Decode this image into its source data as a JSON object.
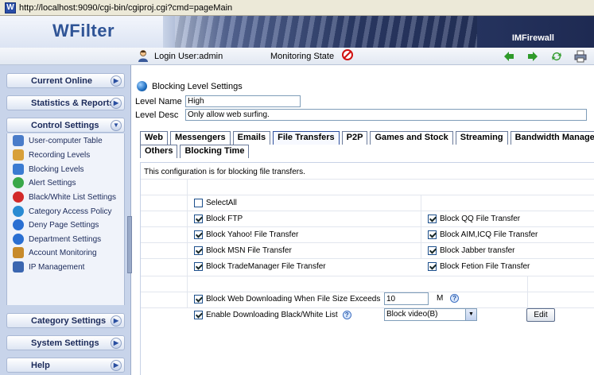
{
  "address_bar": {
    "icon": "wfilter-app-icon",
    "url": "http://localhost:9090/cgi-bin/cgiproj.cgi?cmd=pageMain"
  },
  "banner": {
    "brand": "WFilter",
    "product": "IMFirewall"
  },
  "status_bar": {
    "login": "Login User:admin",
    "monitoring": "Monitoring State",
    "icons": [
      "user-icon",
      "stop-icon",
      "back-arrow-icon",
      "forward-arrow-icon",
      "refresh-icon",
      "print-icon"
    ],
    "colors": {
      "green": "#2f9a2a",
      "stop_red": "#d01010"
    }
  },
  "sidebar": {
    "sections": [
      {
        "label": "Current Online"
      },
      {
        "label": "Statistics & Reports"
      },
      {
        "label": "Control Settings"
      },
      {
        "label": "Category Settings"
      },
      {
        "label": "System Settings"
      },
      {
        "label": "Help"
      }
    ],
    "items": [
      {
        "label": "User-computer Table",
        "icon": "user-table-icon",
        "color": "#4a7cc9"
      },
      {
        "label": "Recording Levels",
        "icon": "recording-icon",
        "color": "#d8a03a"
      },
      {
        "label": "Blocking Levels",
        "icon": "blocking-icon",
        "color": "#3b7bd2"
      },
      {
        "label": "Alert Settings",
        "icon": "alert-icon",
        "color": "#3aa84a"
      },
      {
        "label": "Black/White List Settings",
        "icon": "list-icon",
        "color": "#d22a2a"
      },
      {
        "label": "Category Access Policy",
        "icon": "category-icon",
        "color": "#2a8bd2"
      },
      {
        "label": "Deny Page Settings",
        "icon": "deny-page-icon",
        "color": "#2a6fd2"
      },
      {
        "label": "Department Settings",
        "icon": "department-icon",
        "color": "#2a6fd2"
      },
      {
        "label": "Account Monitoring",
        "icon": "account-icon",
        "color": "#c78a2a"
      },
      {
        "label": "IP Management",
        "icon": "ip-icon",
        "color": "#3b66b0"
      }
    ]
  },
  "main": {
    "title": "Blocking Level Settings",
    "level_name": {
      "label": "Level Name",
      "value": "High"
    },
    "level_desc": {
      "label": "Level Desc",
      "value": "Only allow web surfing."
    },
    "tabs_row1": [
      "Web",
      "Messengers",
      "Emails",
      "File Transfers",
      "P2P",
      "Games and Stock",
      "Streaming",
      "Bandwidth Manage"
    ],
    "tabs_row2": [
      "Others",
      "Blocking Time"
    ],
    "active_tab": "File Transfers",
    "description": "This configuration is for blocking file transfers.",
    "select_all": {
      "label": "SelectAll",
      "checked": false
    },
    "options_left": [
      {
        "label": "Block FTP",
        "checked": true
      },
      {
        "label": "Block Yahoo! File Transfer",
        "checked": true
      },
      {
        "label": "Block MSN File Transfer",
        "checked": true
      },
      {
        "label": "Block TradeManager File Transfer",
        "checked": true
      }
    ],
    "options_right": [
      {
        "label": "Block QQ File Transfer",
        "checked": true
      },
      {
        "label": "Block AIM,ICQ File Transfer",
        "checked": true
      },
      {
        "label": "Block Jabber transfer",
        "checked": true
      },
      {
        "label": "Block Fetion File Transfer",
        "checked": true
      }
    ],
    "size_limit": {
      "label": "Block Web Downloading When File Size Exceeds",
      "value": "10",
      "unit": "M",
      "checked": true
    },
    "download_list": {
      "label": "Enable Downloading Black/White List",
      "checked": true,
      "selected": "Block video(B)",
      "edit_label": "Edit"
    }
  }
}
